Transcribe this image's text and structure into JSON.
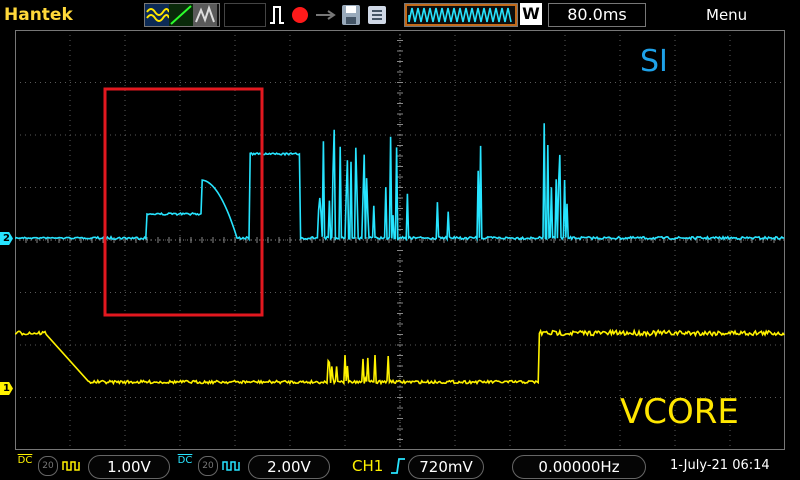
{
  "brand": "Hantek",
  "top_bar": {
    "timebase_mode": "W",
    "timebase": "80.0ms",
    "menu": "Menu"
  },
  "colors": {
    "ch1": "#fff200",
    "ch2": "#27e4ff",
    "annotation_box": "#e3181f",
    "grid": "#5a5a5a",
    "si_label": "#1ea1e8",
    "vcore_label": "#ffe600"
  },
  "screen": {
    "label_si": "SI",
    "label_vcore": "VCORE",
    "ch2_marker": "2",
    "ch1_marker": "1"
  },
  "bottom_bar": {
    "ch1_coupling": "DC",
    "ch1_bw": "20",
    "ch1_scale": "1.00V",
    "ch2_coupling": "DC",
    "ch2_bw": "20",
    "ch2_scale": "2.00V",
    "trigger_source": "CH1",
    "trigger_level": "720mV",
    "frequency": "0.00000Hz",
    "datetime": "1-July-21 06:14"
  }
}
